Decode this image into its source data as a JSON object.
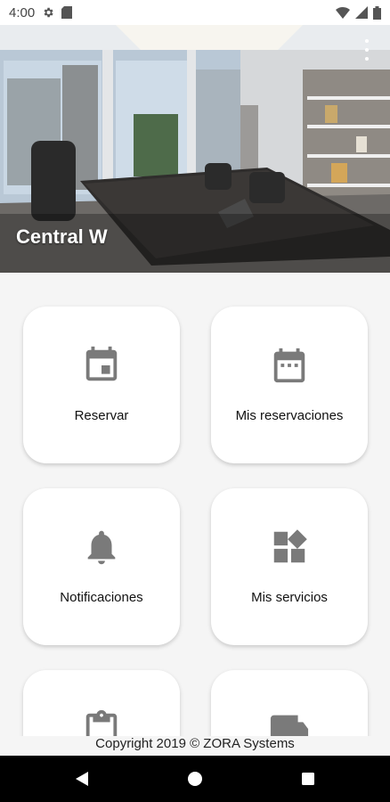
{
  "status_bar": {
    "time": "4:00",
    "icons": [
      "settings-icon",
      "sd-card-icon",
      "wifi-icon",
      "signal-icon",
      "battery-icon"
    ]
  },
  "hero": {
    "title": "Central W",
    "menu_icon": "more-vert-icon"
  },
  "menu": {
    "items": [
      {
        "label": "Reservar",
        "icon": "calendar-event-icon"
      },
      {
        "label": "Mis reservaciones",
        "icon": "calendar-dots-icon"
      },
      {
        "label": "Notificaciones",
        "icon": "bell-icon"
      },
      {
        "label": "Mis servicios",
        "icon": "widgets-icon"
      },
      {
        "label": "",
        "icon": "clipboard-icon"
      },
      {
        "label": "",
        "icon": "truck-icon"
      }
    ]
  },
  "footer": {
    "copyright": "Copyright 2019 © ZORA Systems"
  },
  "nav_bar": {
    "buttons": [
      "back-icon",
      "home-icon",
      "recents-icon"
    ]
  },
  "colors": {
    "icon_gray": "#7a7a7a",
    "background": "#f5f5f5",
    "card": "#ffffff"
  }
}
